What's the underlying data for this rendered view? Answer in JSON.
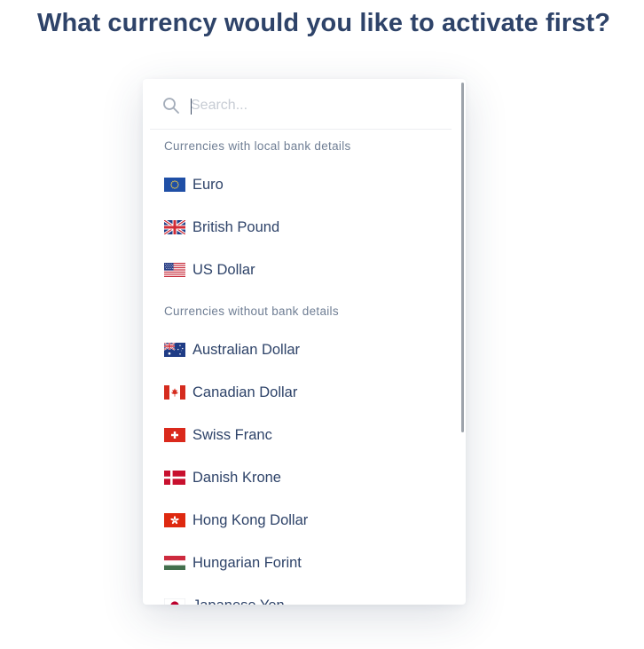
{
  "heading": "What currency would you like to activate first?",
  "search": {
    "placeholder": "Search...",
    "value": ""
  },
  "groups": [
    {
      "title": "Currencies with local bank details",
      "items": [
        {
          "label": "Euro",
          "flag": "eu-flag-icon"
        },
        {
          "label": "British Pound",
          "flag": "gb-flag-icon"
        },
        {
          "label": "US Dollar",
          "flag": "us-flag-icon"
        }
      ]
    },
    {
      "title": "Currencies without bank details",
      "items": [
        {
          "label": "Australian Dollar",
          "flag": "au-flag-icon"
        },
        {
          "label": "Canadian Dollar",
          "flag": "ca-flag-icon"
        },
        {
          "label": "Swiss Franc",
          "flag": "ch-flag-icon"
        },
        {
          "label": "Danish Krone",
          "flag": "dk-flag-icon"
        },
        {
          "label": "Hong Kong Dollar",
          "flag": "hk-flag-icon"
        },
        {
          "label": "Hungarian Forint",
          "flag": "hu-flag-icon"
        },
        {
          "label": "Japanese Yen",
          "flag": "jp-flag-icon"
        }
      ]
    }
  ],
  "colors": {
    "heading": "#2e4369",
    "item_text": "#2e4369",
    "group_header_text": "#6f7e94",
    "placeholder": "#c7ccd4",
    "scrollbar": "#9da3ab"
  }
}
